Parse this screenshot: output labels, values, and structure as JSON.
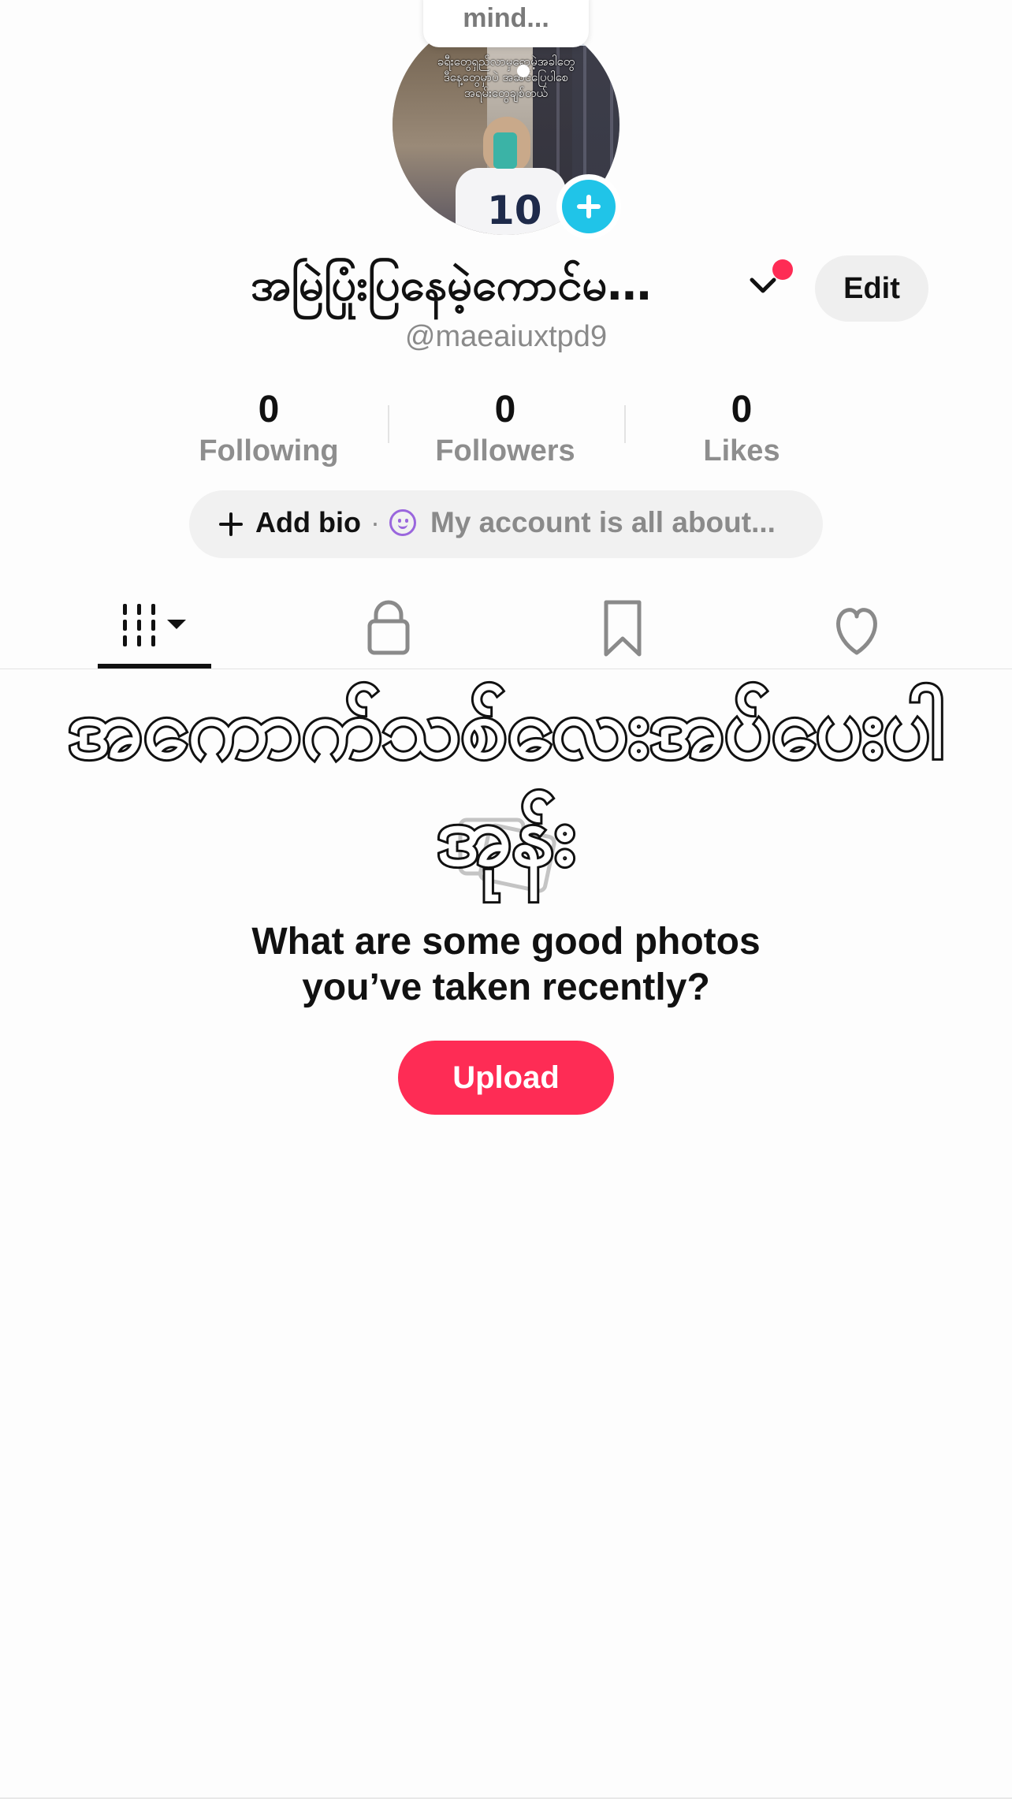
{
  "thought_bubble": {
    "text": "mind..."
  },
  "profile": {
    "avatar_overlay_text": "ခရီးတွေရှည်လာမှရော့မဲ့အခါတွေ\nဒီနေ့တွေမှာပဲ အဆင်ပြေပါစေ\nအရမ်းတွေချစ်တယ်",
    "avatar_shirt_number": "10",
    "display_name": "အမြဲပြုံးပြနေမဲ့ကောင်မ…",
    "username": "@maeaiuxtpd9",
    "edit_label": "Edit",
    "notification_color": "#fe2c55"
  },
  "stats": [
    {
      "value": "0",
      "label": "Following"
    },
    {
      "value": "0",
      "label": "Followers"
    },
    {
      "value": "0",
      "label": "Likes"
    }
  ],
  "bio": {
    "add_label": "Add bio",
    "separator": "·",
    "placeholder": "My account is all about..."
  },
  "tabs": [
    {
      "name": "videos-grid",
      "icon": "grid-bars-icon",
      "selected": true
    },
    {
      "name": "private",
      "icon": "lock-icon",
      "selected": false
    },
    {
      "name": "favorites",
      "icon": "bookmark-icon",
      "selected": false
    },
    {
      "name": "liked",
      "icon": "heart-icon",
      "selected": false
    }
  ],
  "sticker_text": "အကောက်သစ်လေးအပ်ပေးပါ အုန်း",
  "empty_state": {
    "title": "What are some good photos you’ve taken recently?",
    "upload_label": "Upload",
    "accent_color": "#fe2c55"
  }
}
